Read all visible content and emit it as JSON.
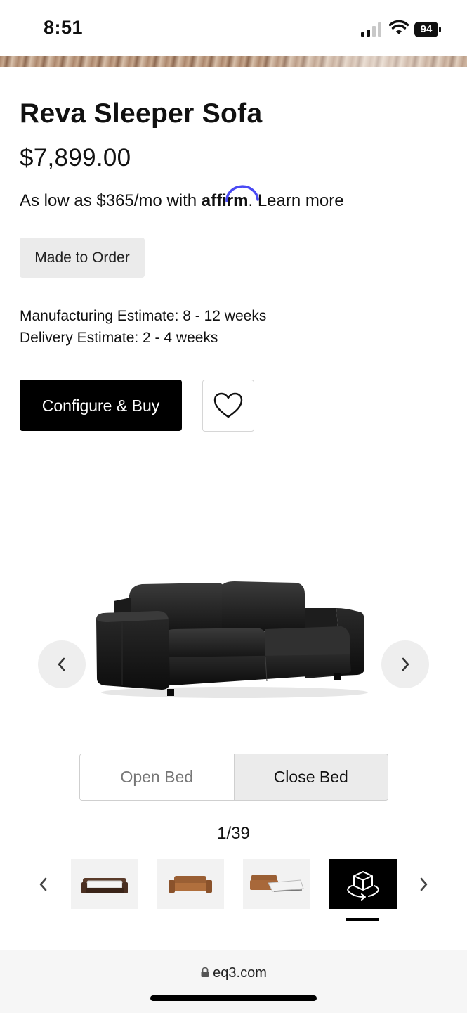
{
  "status_bar": {
    "time": "8:51",
    "battery": "94"
  },
  "product": {
    "title": "Reva Sleeper Sofa",
    "price": "$7,899.00",
    "financing": {
      "prefix": "As low as $365/mo with",
      "brand": "affirm",
      "suffix": ".",
      "learn_more": "Learn more"
    },
    "badge": "Made to Order",
    "manufacturing_estimate": "Manufacturing Estimate: 8 - 12 weeks",
    "delivery_estimate": "Delivery Estimate: 2 - 4 weeks",
    "configure_button": "Configure & Buy"
  },
  "gallery": {
    "toggle": {
      "open_label": "Open Bed",
      "close_label": "Close Bed",
      "selected": "Close Bed"
    },
    "counter": "1/39",
    "thumbnails": [
      "sofa-bed-open-icon",
      "sofa-brown-icon",
      "sofa-bed-pulled-icon",
      "3d-view-icon"
    ],
    "active_thumbnail": 4
  },
  "browser": {
    "url": "eq3.com"
  },
  "colors": {
    "primary": "#000000",
    "affirm": "#4a4af4",
    "badge_bg": "#ebebeb"
  }
}
